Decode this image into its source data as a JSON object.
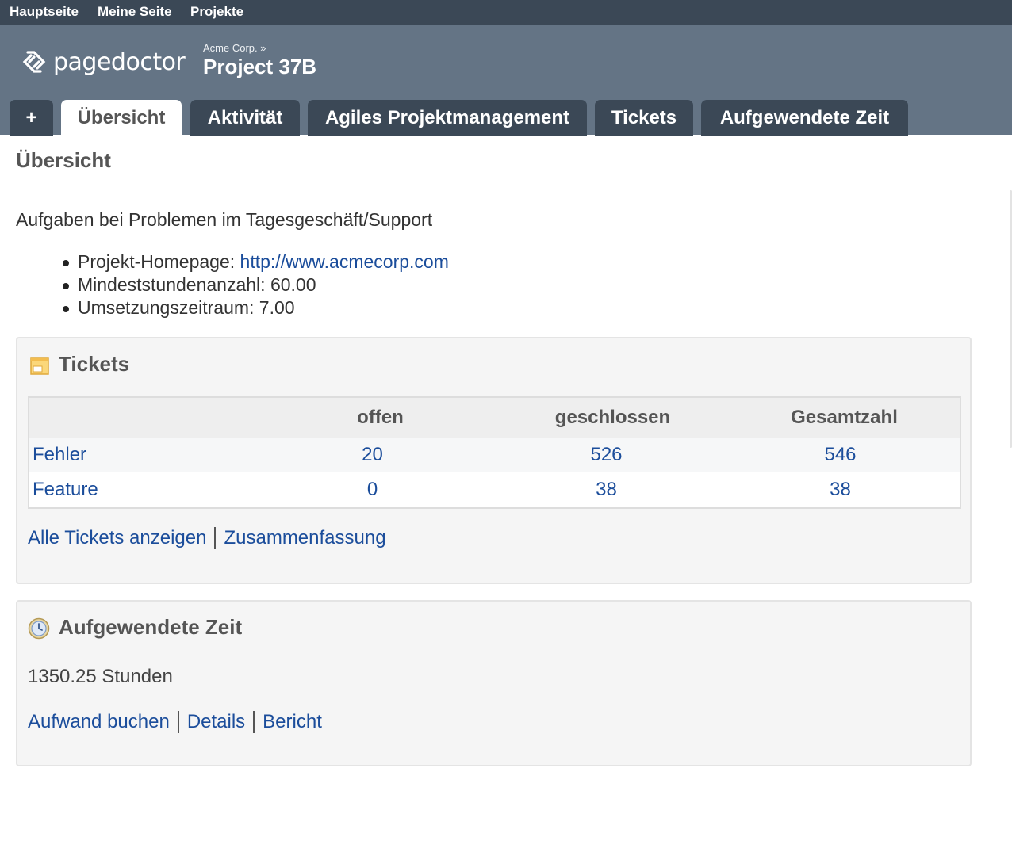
{
  "top_menu": {
    "home": "Hauptseite",
    "my_page": "Meine Seite",
    "projects": "Projekte"
  },
  "header": {
    "logo_text": "pagedoctor",
    "breadcrumb": "Acme Corp. »",
    "project_title": "Project 37B"
  },
  "tabs": {
    "new": "+",
    "overview": "Übersicht",
    "activity": "Aktivität",
    "agile": "Agiles Projektmanagement",
    "tickets": "Tickets",
    "time": "Aufgewendete Zeit"
  },
  "page": {
    "title": "Übersicht",
    "description": "Aufgaben bei Problemen im Tagesgeschäft/Support",
    "info": {
      "homepage_label": "Projekt-Homepage: ",
      "homepage_url": "http://www.acmecorp.com",
      "min_hours": "Mindeststundenanzahl: 60.00",
      "period": "Umsetzungszeitraum: 7.00"
    }
  },
  "tickets_box": {
    "title": "Tickets",
    "columns": {
      "open": "offen",
      "closed": "geschlossen",
      "total": "Gesamtzahl"
    },
    "rows": [
      {
        "tracker": "Fehler",
        "open": "20",
        "closed": "526",
        "total": "546"
      },
      {
        "tracker": "Feature",
        "open": "0",
        "closed": "38",
        "total": "38"
      }
    ],
    "links": {
      "all": "Alle Tickets anzeigen",
      "summary": "Zusammenfassung"
    }
  },
  "time_box": {
    "title": "Aufgewendete Zeit",
    "hours": "1350.25 Stunden",
    "links": {
      "log": "Aufwand buchen",
      "details": "Details",
      "report": "Bericht"
    }
  },
  "icons": {
    "logo": "pagedoctor-logo-icon",
    "tickets": "ticket-icon",
    "time": "clock-icon"
  },
  "colors": {
    "top_menu_bg": "#3b4856",
    "header_bg": "#647485",
    "link": "#1b4d9b"
  }
}
